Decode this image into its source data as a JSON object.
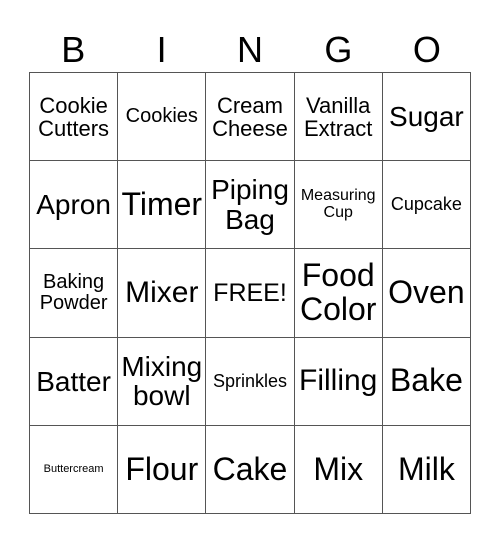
{
  "header": [
    "B",
    "I",
    "N",
    "G",
    "O"
  ],
  "cells": [
    [
      "Cookie\nCutters",
      "Cookies",
      "Cream\nCheese",
      "Vanilla\nExtract",
      "Sugar"
    ],
    [
      "Apron",
      "Timer",
      "Piping\nBag",
      "Measuring\nCup",
      "Cupcake"
    ],
    [
      "Baking\nPowder",
      "Mixer",
      "FREE!",
      "Food\nColor",
      "Oven"
    ],
    [
      "Batter",
      "Mixing\nbowl",
      "Sprinkles",
      "Filling",
      "Bake"
    ],
    [
      "Buttercream",
      "Flour",
      "Cake",
      "Mix",
      "Milk"
    ]
  ]
}
